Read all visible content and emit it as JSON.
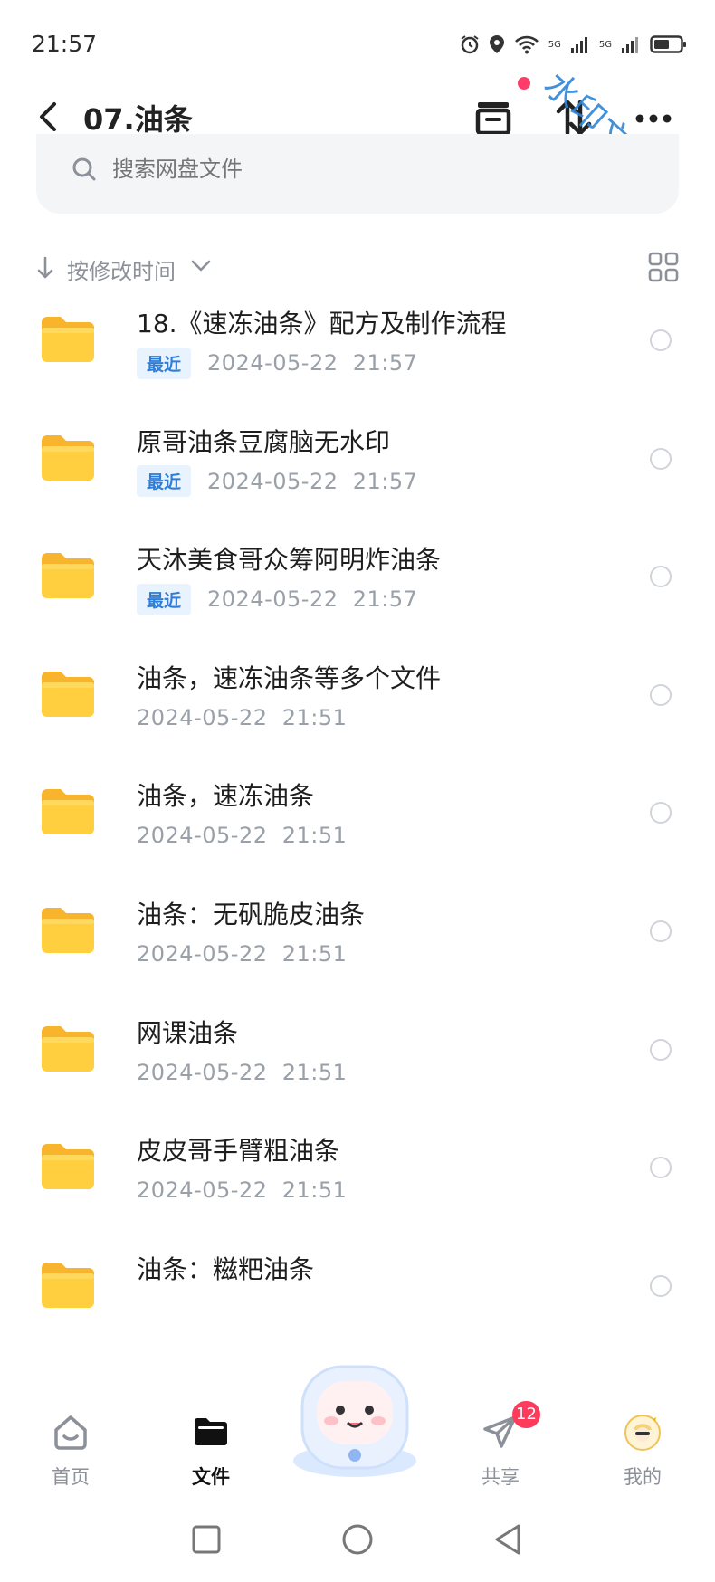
{
  "status": {
    "time": "21:57",
    "net1": "5G",
    "net2": "5G",
    "icons": [
      "alarm-icon",
      "location-icon",
      "wifi-icon",
      "signal-icon",
      "signal-icon",
      "battery-icon"
    ]
  },
  "header": {
    "title": "07.油条",
    "icons": [
      "back-icon",
      "transfer-box-icon",
      "sort-swap-icon",
      "more-icon"
    ],
    "watermark": "水印文字"
  },
  "search": {
    "placeholder": "搜索网盘文件"
  },
  "sort": {
    "label": "按修改时间"
  },
  "files": [
    {
      "name": "18.《速冻油条》配方及制作流程",
      "badge": "最近",
      "date": "2024-05-22  21:57"
    },
    {
      "name": "原哥油条豆腐脑无水印",
      "badge": "最近",
      "date": "2024-05-22  21:57"
    },
    {
      "name": "天沐美食哥众筹阿明炸油条",
      "badge": "最近",
      "date": "2024-05-22  21:57"
    },
    {
      "name": "油条，速冻油条等多个文件",
      "badge": "",
      "date": "2024-05-22  21:51"
    },
    {
      "name": "油条，速冻油条",
      "badge": "",
      "date": "2024-05-22  21:51"
    },
    {
      "name": "油条：无矾脆皮油条",
      "badge": "",
      "date": "2024-05-22  21:51"
    },
    {
      "name": "网课油条",
      "badge": "",
      "date": "2024-05-22  21:51"
    },
    {
      "name": "皮皮哥手臂粗油条",
      "badge": "",
      "date": "2024-05-22  21:51"
    },
    {
      "name": "油条：糍粑油条",
      "badge": "",
      "date": ""
    }
  ],
  "tabs": [
    {
      "label": "首页",
      "icon": "home-icon"
    },
    {
      "label": "文件",
      "icon": "folder-icon"
    },
    {
      "label": "共享",
      "icon": "share-icon",
      "badge": "12"
    },
    {
      "label": "我的",
      "icon": "avatar"
    }
  ],
  "colors": {
    "accent": "#2f7dd6",
    "folder": "#ffc93a",
    "badge": "#ff3b5c"
  }
}
